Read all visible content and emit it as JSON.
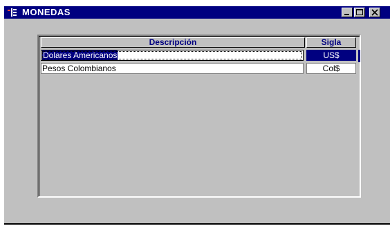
{
  "window": {
    "title": "MONEDAS",
    "icon": "app-form-icon",
    "controls": [
      "minimize-icon",
      "maximize-icon",
      "close-icon"
    ]
  },
  "table": {
    "columns": {
      "description": "Descripción",
      "sigla": "Sigla"
    },
    "rows": [
      {
        "description": "Dolares Americanos",
        "sigla": "US$",
        "selected": true
      },
      {
        "description": "Pesos Colombianos",
        "sigla": "Col$",
        "selected": false
      }
    ]
  },
  "colors": {
    "titlebar": "#000080",
    "window_bg": "#c0c0c0",
    "header_text": "#000080",
    "selection": "#000080"
  }
}
